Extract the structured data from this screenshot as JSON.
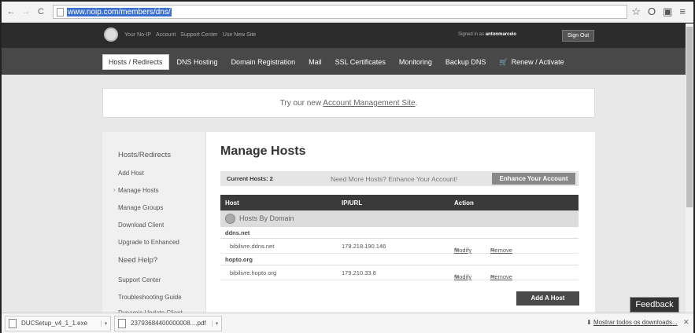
{
  "browser": {
    "url": "www.noip.com/members/dns/"
  },
  "topbar": {
    "links": [
      "Your No-IP",
      "Account",
      "Support Center",
      "Use New Site"
    ],
    "signed_in_prefix": "Signed in as",
    "username": "antonmarcelo",
    "signout_label": "Sign Out"
  },
  "nav": {
    "items": [
      "Hosts / Redirects",
      "DNS Hosting",
      "Domain Registration",
      "Mail",
      "SSL Certificates",
      "Monitoring",
      "Backup DNS",
      "Renew / Activate"
    ],
    "active_index": 0
  },
  "banner": {
    "prefix": "Try our new ",
    "link": "Account Management Site",
    "suffix": "."
  },
  "sidebar": {
    "heading1": "Hosts/Redirects",
    "items1": [
      "Add Host",
      "Manage Hosts",
      "Manage Groups",
      "Download Client",
      "Upgrade to Enhanced"
    ],
    "heading2": "Need Help?",
    "items2": [
      "Support Center",
      "Troubleshooting Guide",
      "Dynamic Update Client"
    ]
  },
  "main": {
    "title": "Manage Hosts",
    "current_hosts": "Current Hosts: 2",
    "need_more": "Need More Hosts? Enhance Your Account!",
    "enhance_label": "Enhance Your Account",
    "columns": [
      "Host",
      "IP/URL",
      "Action"
    ],
    "group_label": "Hosts By Domain",
    "domains": [
      {
        "name": "ddns.net",
        "host": "bibilivre.ddns.net",
        "ip": "179.218.190.146"
      },
      {
        "name": "hopto.org",
        "host": "bibilivre.hopto.org",
        "ip": "179.210.33.8"
      }
    ],
    "modify_label": "Modify",
    "remove_label": "Remove",
    "add_host_label": "Add A Host"
  },
  "feedback_label": "Feedback",
  "downloads": {
    "items": [
      "DUCSetup_v4_1_1.exe",
      "23793684400000008....pdf"
    ],
    "show_all": "Mostrar todos os downloads..."
  }
}
